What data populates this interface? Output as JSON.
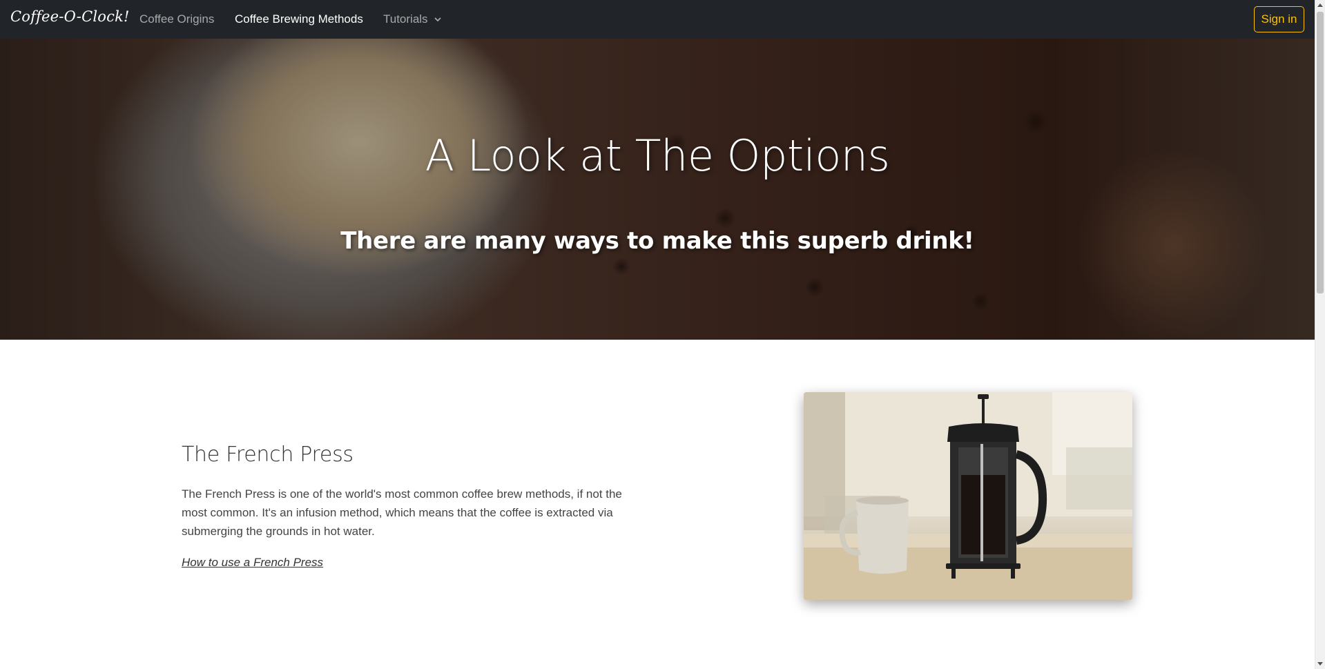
{
  "navbar": {
    "brand": "Coffee-O-Clock!",
    "links": [
      {
        "label": "Coffee Origins",
        "active": false
      },
      {
        "label": "Coffee Brewing Methods",
        "active": true
      },
      {
        "label": "Tutorials",
        "active": false,
        "icon": "chevron-down-icon"
      }
    ],
    "signin_label": "Sign in",
    "accent_color": "#ffc107",
    "background_color": "#212529"
  },
  "hero": {
    "title": "A Look at The Options",
    "subtitle": "There are many ways to make this superb drink!"
  },
  "section": {
    "title": "The French Press",
    "text": "The French Press is one of the world's most common coffee brew methods, if not the most common. It's an infusion method, which means that the coffee is extracted via submerging the grounds in hot water.",
    "link": "How to use a French Press"
  }
}
